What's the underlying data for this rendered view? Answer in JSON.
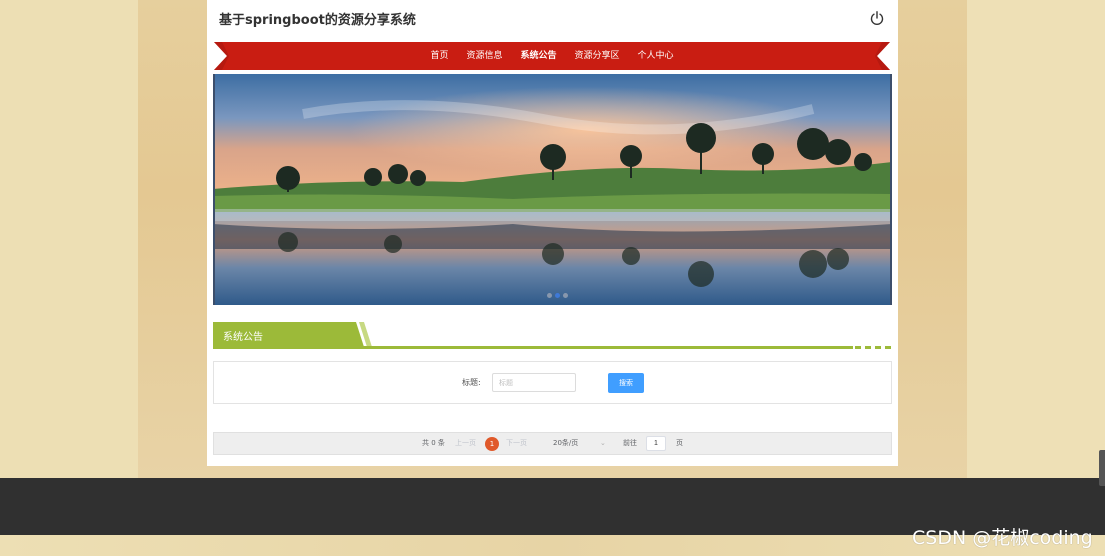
{
  "site": {
    "title": "基于springboot的资源分享系统"
  },
  "header": {
    "power_icon": "power-icon"
  },
  "nav": {
    "items": [
      {
        "label": "首页"
      },
      {
        "label": "资源信息"
      },
      {
        "label": "系统公告",
        "active": true
      },
      {
        "label": "资源分享区"
      },
      {
        "label": "个人中心"
      }
    ],
    "colors": {
      "ribbon": "#c91d12"
    }
  },
  "banner": {
    "slides_count": 3,
    "active_slide": 2
  },
  "section": {
    "title": "系统公告",
    "accent_color": "#9cba39"
  },
  "search": {
    "label": "标题:",
    "placeholder": "标题",
    "value": "",
    "button_label": "搜索",
    "button_color": "#409eff"
  },
  "pagination": {
    "total": "共 0 条",
    "prev": "上一页",
    "current": "1",
    "next": "下一页",
    "page_size": "20条/页",
    "goto": "前往",
    "jump_value": "1",
    "page_suffix": "页",
    "current_color": "#e0592a"
  },
  "watermark": "CSDN @花椒coding"
}
